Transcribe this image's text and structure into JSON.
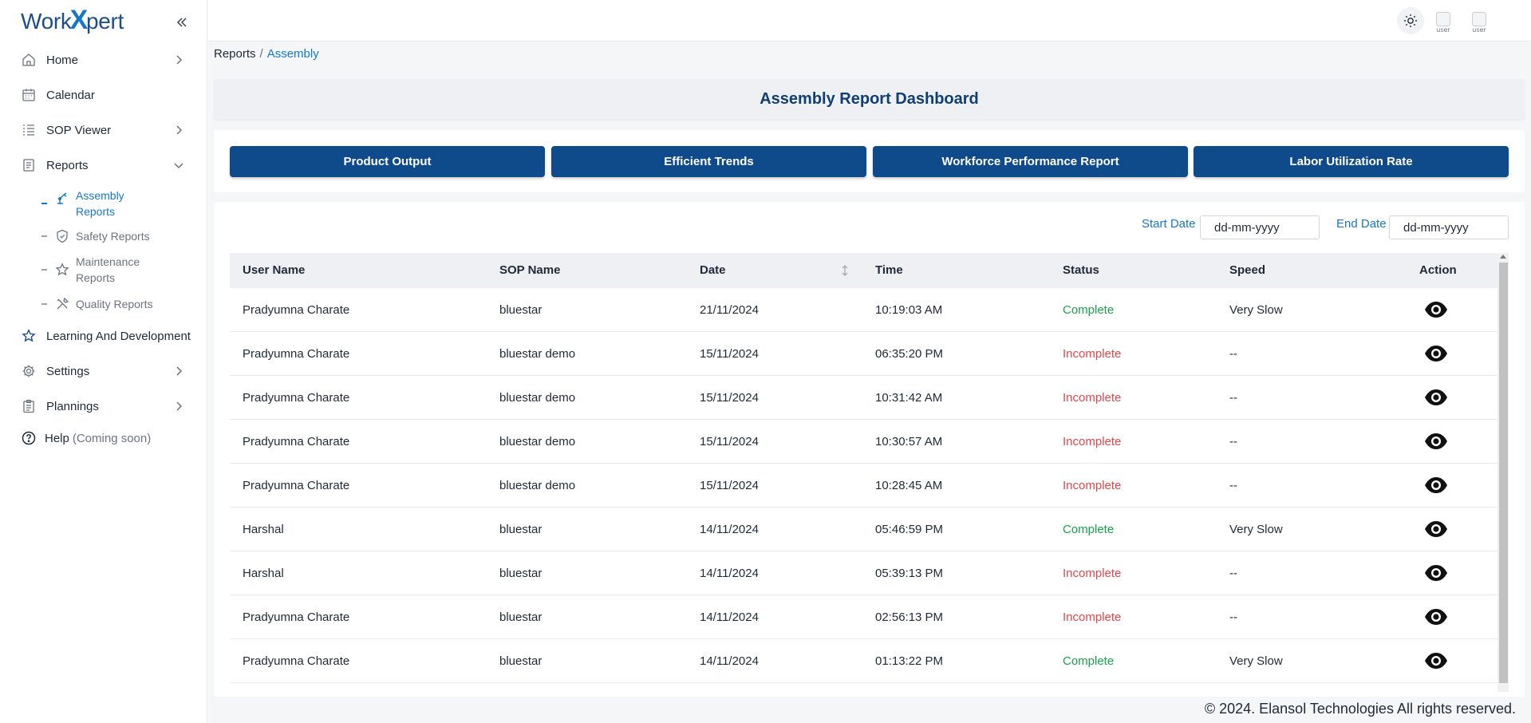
{
  "logo": {
    "part1": "Work",
    "part2": "X",
    "part3": "pert"
  },
  "sidebar": {
    "items": [
      {
        "label": "Home"
      },
      {
        "label": "Calendar"
      },
      {
        "label": "SOP Viewer"
      },
      {
        "label": "Reports"
      }
    ],
    "sub_items": [
      {
        "label_line1": "Assembly",
        "label_line2": "Reports"
      },
      {
        "label_line1": "Safety Reports"
      },
      {
        "label_line1": "Maintenance",
        "label_line2": "Reports"
      },
      {
        "label_line1": "Quality Reports"
      }
    ],
    "items_after": [
      {
        "label": "Learning And Development"
      },
      {
        "label": "Settings"
      },
      {
        "label": "Plannings"
      }
    ],
    "help": {
      "label": "Help",
      "soon": "(Coming soon)"
    }
  },
  "topbar": {
    "avatar_alt": "user"
  },
  "breadcrumb": {
    "parent": "Reports",
    "separator": "/",
    "current": "Assembly"
  },
  "page_title": "Assembly Report Dashboard",
  "report_buttons": [
    "Product Output",
    "Efficient Trends",
    "Workforce Performance Report",
    "Labor Utilization Rate"
  ],
  "filters": {
    "start_label": "Start Date",
    "start_placeholder": "dd-mm-yyyy",
    "end_label": "End Date",
    "end_placeholder": "dd-mm-yyyy"
  },
  "table": {
    "headers": [
      "User Name",
      "SOP Name",
      "Date",
      "Time",
      "Status",
      "Speed",
      "Action"
    ],
    "rows": [
      [
        "Pradyumna Charate",
        "bluestar",
        "21/11/2024",
        "10:19:03 AM",
        "Complete",
        "Very Slow"
      ],
      [
        "Pradyumna Charate",
        "bluestar demo",
        "15/11/2024",
        "06:35:20 PM",
        "Incomplete",
        "--"
      ],
      [
        "Pradyumna Charate",
        "bluestar demo",
        "15/11/2024",
        "10:31:42 AM",
        "Incomplete",
        "--"
      ],
      [
        "Pradyumna Charate",
        "bluestar demo",
        "15/11/2024",
        "10:30:57 AM",
        "Incomplete",
        "--"
      ],
      [
        "Pradyumna Charate",
        "bluestar demo",
        "15/11/2024",
        "10:28:45 AM",
        "Incomplete",
        "--"
      ],
      [
        "Harshal",
        "bluestar",
        "14/11/2024",
        "05:46:59 PM",
        "Complete",
        "Very Slow"
      ],
      [
        "Harshal",
        "bluestar",
        "14/11/2024",
        "05:39:13 PM",
        "Incomplete",
        "--"
      ],
      [
        "Pradyumna Charate",
        "bluestar",
        "14/11/2024",
        "02:56:13 PM",
        "Incomplete",
        "--"
      ],
      [
        "Pradyumna Charate",
        "bluestar",
        "14/11/2024",
        "01:13:22 PM",
        "Complete",
        "Very Slow"
      ]
    ]
  },
  "colors": {
    "primary": "#0f4a8a",
    "accent": "#1677c9",
    "complete": "#16a34a",
    "incomplete": "#e0474c"
  },
  "footer": "© 2024. Elansol Technologies All rights reserved."
}
